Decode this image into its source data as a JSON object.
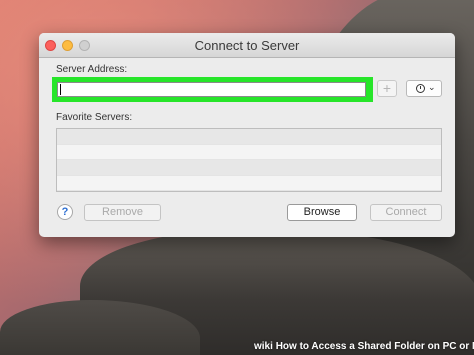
{
  "window": {
    "title": "Connect to Server"
  },
  "server_address": {
    "label": "Server Address:",
    "value": "",
    "placeholder": ""
  },
  "toolbar": {
    "add_label": "+",
    "recent_icon": "clock-icon",
    "recent_chevron": "chevron-down-icon"
  },
  "favorites": {
    "label": "Favorite Servers:",
    "rows": [
      "",
      "",
      "",
      ""
    ]
  },
  "buttons": {
    "help_label": "?",
    "remove_label": "Remove",
    "browse_label": "Browse",
    "connect_label": "Connect"
  },
  "watermark": {
    "logo": "wiki",
    "text": "How to Access a Shared Folder on PC or Mac"
  },
  "colors": {
    "highlight": "#27e52a",
    "close": "#fc605c",
    "minimize": "#fdbc40",
    "zoom_disabled": "#d0d0d0"
  }
}
